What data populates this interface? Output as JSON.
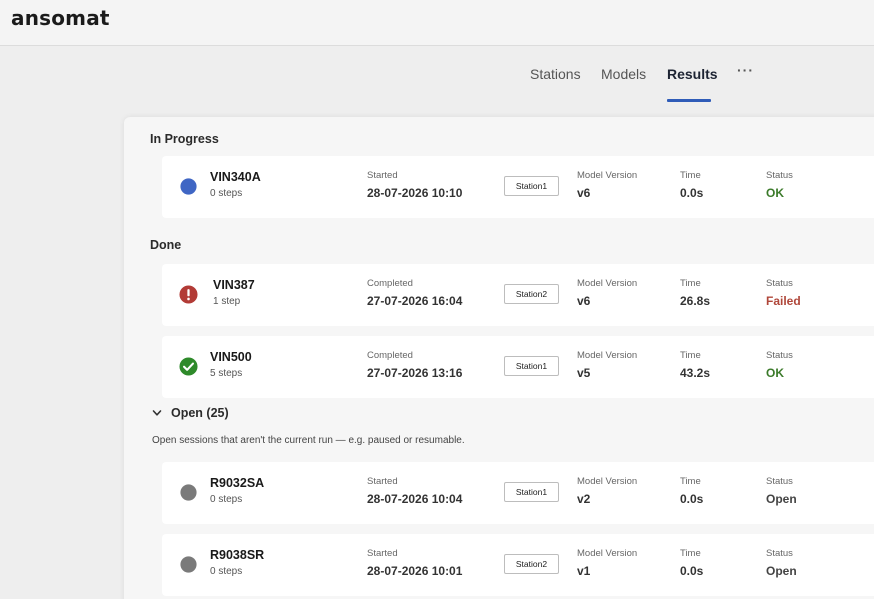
{
  "app": {
    "logo": "ansomat"
  },
  "nav": {
    "tabs": [
      {
        "label": "Stations",
        "active": false
      },
      {
        "label": "Models",
        "active": false
      },
      {
        "label": "Results",
        "active": true
      }
    ],
    "more": "···"
  },
  "sections": {
    "in_progress": "In Progress",
    "done": "Done",
    "open": "Open (25)",
    "open_desc": "Open sessions that aren't the current run — e.g. paused or resumable."
  },
  "labels": {
    "started": "Started",
    "completed": "Completed",
    "model_version": "Model Version",
    "time": "Time",
    "status": "Status"
  },
  "in_progress": [
    {
      "vin": "VIN340A",
      "steps": "0 steps",
      "date": "28-07-2026 10:10",
      "station": "Station1",
      "model": "v6",
      "time": "0.0s",
      "status": "OK",
      "icon": "blue-dot-icon"
    }
  ],
  "done": [
    {
      "vin": "VIN387",
      "steps": "1 step",
      "date": "27-07-2026 16:04",
      "station": "Station2",
      "model": "v6",
      "time": "26.8s",
      "status": "Failed",
      "icon": "error-icon"
    },
    {
      "vin": "VIN500",
      "steps": "5 steps",
      "date": "27-07-2026 13:16",
      "station": "Station1",
      "model": "v5",
      "time": "43.2s",
      "status": "OK",
      "icon": "check-icon"
    }
  ],
  "open": [
    {
      "vin": "R9032SA",
      "steps": "0 steps",
      "date": "28-07-2026 10:04",
      "station": "Station1",
      "model": "v2",
      "time": "0.0s",
      "status": "Open",
      "icon": "gray-dot-icon"
    },
    {
      "vin": "R9038SR",
      "steps": "0 steps",
      "date": "28-07-2026 10:01",
      "station": "Station2",
      "model": "v1",
      "time": "0.0s",
      "status": "Open",
      "icon": "gray-dot-icon"
    }
  ],
  "colors": {
    "accent": "#2f5cb8",
    "ok": "#3b7a2a",
    "failed": "#b0473a",
    "blue_dot": "#3f66c4",
    "error_red": "#b23b36",
    "check_green": "#2e8a2a",
    "gray_dot": "#7a7a7a"
  }
}
